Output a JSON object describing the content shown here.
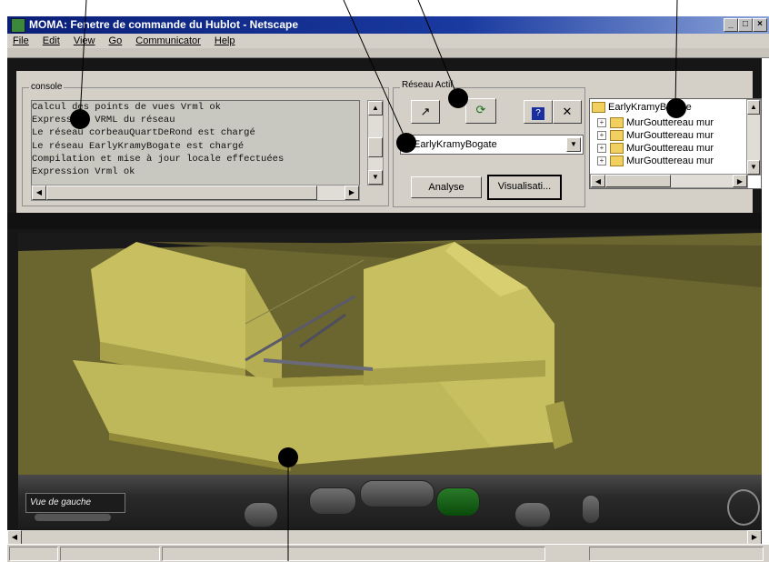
{
  "window": {
    "title": "MOMA: Fenetre de commande du Hublot - Netscape"
  },
  "menu": {
    "items": [
      "File",
      "Edit",
      "View",
      "Go",
      "Communicator",
      "Help"
    ]
  },
  "console": {
    "group_label": "console",
    "lines": [
      "Calcul des points de vues Vrml ok",
      "Expression VRML du réseau",
      "Le réseau corbeauQuartDeRond est chargé",
      "Le réseau EarlyKramyBogate est chargé",
      "Compilation et mise à jour locale effectuées",
      "Expression Vrml ok"
    ]
  },
  "reseau": {
    "group_label": "Réseau Actif",
    "selected_network": "EarlyKramyBogate",
    "analyse_label": "Analyse",
    "visualisation_label": "Visualisati...",
    "tool_icons": [
      "pointer-icon",
      "refresh-icon",
      "help-icon",
      "close-icon"
    ]
  },
  "tree": {
    "root": "EarlyKramyBogate",
    "children": [
      "MurGouttereau mur",
      "MurGouttereau mur",
      "MurGouttereau mur",
      "MurGouttereau mur"
    ]
  },
  "viewer": {
    "viewpoint_label": "Vue de gauche",
    "nav_icons": [
      "walk-icon",
      "pan-icon",
      "rotate-icon",
      "move-icon",
      "tilt-icon",
      "zoom-icon"
    ]
  },
  "colors": {
    "title_bar": "#0a1f78",
    "face": "#d4d0c8",
    "model": "#c8c060",
    "ground": "#6b6530"
  }
}
